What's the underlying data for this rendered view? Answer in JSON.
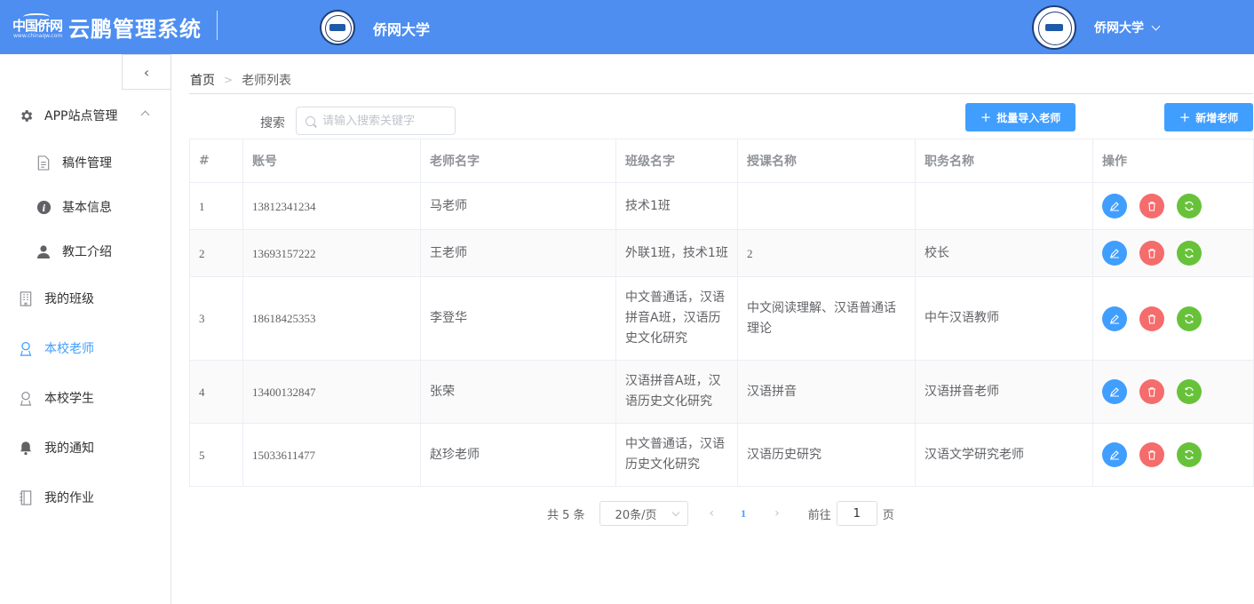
{
  "header": {
    "logo_text_zh": "中国侨网",
    "logo_url": "www.chinaqw.com",
    "app_title": "云鹏管理系统",
    "school_center": "侨网大学",
    "school_right": "侨网大学"
  },
  "sidebar": {
    "collapse_glyph": "‹",
    "items": [
      {
        "label": "APP站点管理",
        "icon": "gear-icon"
      },
      {
        "label": "稿件管理",
        "icon": "document-icon"
      },
      {
        "label": "基本信息",
        "icon": "info-icon"
      },
      {
        "label": "教工介绍",
        "icon": "user-icon"
      },
      {
        "label": "我的班级",
        "icon": "building-icon"
      },
      {
        "label": "本校老师",
        "icon": "person-icon"
      },
      {
        "label": "本校学生",
        "icon": "person-icon"
      },
      {
        "label": "我的通知",
        "icon": "bell-icon"
      },
      {
        "label": "我的作业",
        "icon": "notebook-icon"
      }
    ]
  },
  "breadcrumb": {
    "home": "首页",
    "sep": ">",
    "current": "老师列表"
  },
  "toolbar": {
    "search_label": "搜索",
    "search_placeholder": "请输入搜索关键字",
    "import_label": "批量导入老师",
    "add_label": "新增老师"
  },
  "table": {
    "headers": [
      "#",
      "账号",
      "老师名字",
      "班级名字",
      "授课名称",
      "职务名称",
      "操作"
    ],
    "rows": [
      {
        "idx": "1",
        "account": "13812341234",
        "name": "马老师",
        "classes": "技术1班",
        "course": "",
        "title": ""
      },
      {
        "idx": "2",
        "account": "13693157222",
        "name": "王老师",
        "classes": "外联1班，技术1班",
        "course": "2",
        "title": "校长"
      },
      {
        "idx": "3",
        "account": "18618425353",
        "name": "李登华",
        "classes": "中文普通话，汉语拼音A班，汉语历史文化研究",
        "course": "中文阅读理解、汉语普通话理论",
        "title": "中午汉语教师"
      },
      {
        "idx": "4",
        "account": "13400132847",
        "name": "张荣",
        "classes": "汉语拼音A班，汉语历史文化研究",
        "course": "汉语拼音",
        "title": "汉语拼音老师"
      },
      {
        "idx": "5",
        "account": "15033611477",
        "name": "赵珍老师",
        "classes": "中文普通话，汉语历史文化研究",
        "course": "汉语历史研究",
        "title": "汉语文学研究老师"
      }
    ]
  },
  "pagination": {
    "total": "共 5 条",
    "page_size": "20条/页",
    "prev": "‹",
    "current_page": "1",
    "next": "›",
    "goto_label": "前往",
    "goto_value": "1",
    "page_suffix": "页"
  },
  "colors": {
    "header_bg": "#4d8ef0",
    "primary": "#409eff",
    "danger": "#f56c6c",
    "success": "#67c23a"
  }
}
